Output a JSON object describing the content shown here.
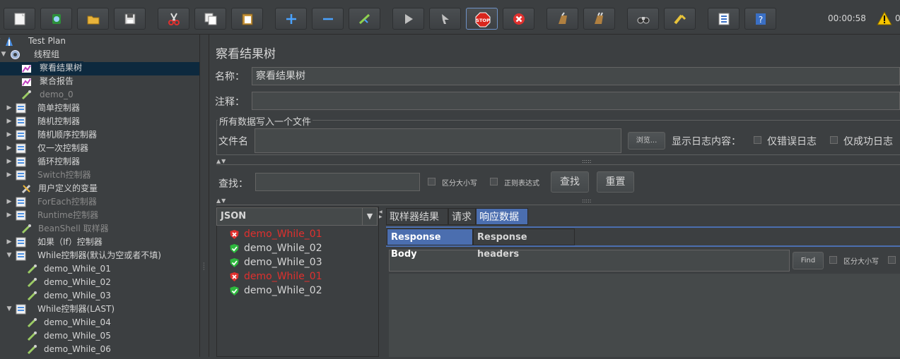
{
  "toolbar": {
    "buttons": [
      {
        "name": "new-icon"
      },
      {
        "name": "templates-icon"
      },
      {
        "name": "open-icon"
      },
      {
        "name": "save-icon"
      },
      {
        "name": "cut-icon"
      },
      {
        "name": "copy-icon"
      },
      {
        "name": "paste-icon"
      },
      {
        "name": "expand-icon"
      },
      {
        "name": "collapse-icon"
      },
      {
        "name": "toggle-icon"
      },
      {
        "name": "start-icon"
      },
      {
        "name": "start-no-pause-icon"
      },
      {
        "name": "stop-icon"
      },
      {
        "name": "shutdown-icon"
      },
      {
        "name": "clear-icon"
      },
      {
        "name": "clear-all-icon"
      },
      {
        "name": "search-icon"
      },
      {
        "name": "reset-search-icon"
      },
      {
        "name": "function-helper-icon"
      },
      {
        "name": "help-icon"
      }
    ],
    "stop_label": "STOP",
    "timer": "00:00:58",
    "warning_count": "0"
  },
  "tree": {
    "items": [
      {
        "label": "Test Plan",
        "icon": "test-plan-icon",
        "toggle": "▼",
        "disabled": false
      },
      {
        "label": "线程组",
        "icon": "gear-icon",
        "toggle": "▼",
        "disabled": false
      },
      {
        "label": "察看结果树",
        "icon": "listener-icon",
        "toggle": "",
        "disabled": false,
        "selected": true
      },
      {
        "label": "聚合报告",
        "icon": "listener-icon",
        "toggle": "",
        "disabled": false
      },
      {
        "label": "demo_0",
        "icon": "sampler-icon",
        "toggle": "",
        "disabled": true
      },
      {
        "label": "简单控制器",
        "icon": "controller-icon",
        "toggle": "▶",
        "disabled": false
      },
      {
        "label": "随机控制器",
        "icon": "controller-icon",
        "toggle": "▶",
        "disabled": false
      },
      {
        "label": "随机顺序控制器",
        "icon": "controller-icon",
        "toggle": "▶",
        "disabled": false
      },
      {
        "label": "仅一次控制器",
        "icon": "controller-icon",
        "toggle": "▶",
        "disabled": false
      },
      {
        "label": "循环控制器",
        "icon": "controller-icon",
        "toggle": "▶",
        "disabled": false
      },
      {
        "label": "Switch控制器",
        "icon": "controller-icon",
        "toggle": "▶",
        "disabled": true
      },
      {
        "label": "用户定义的变量",
        "icon": "wrench-icon",
        "toggle": "",
        "disabled": false
      },
      {
        "label": "ForEach控制器",
        "icon": "controller-icon",
        "toggle": "▶",
        "disabled": true
      },
      {
        "label": "Runtime控制器",
        "icon": "controller-icon",
        "toggle": "▶",
        "disabled": true
      },
      {
        "label": "BeanShell 取样器",
        "icon": "sampler-icon",
        "toggle": "",
        "disabled": true
      },
      {
        "label": "如果（If）控制器",
        "icon": "controller-icon",
        "toggle": "▶",
        "disabled": false
      },
      {
        "label": "While控制器(默认为空或者不填)",
        "icon": "controller-icon",
        "toggle": "▼",
        "disabled": false
      },
      {
        "label": "demo_While_01",
        "icon": "sampler-icon",
        "toggle": "",
        "disabled": false
      },
      {
        "label": "demo_While_02",
        "icon": "sampler-icon",
        "toggle": "",
        "disabled": false
      },
      {
        "label": "demo_While_03",
        "icon": "sampler-icon",
        "toggle": "",
        "disabled": false
      },
      {
        "label": "While控制器(LAST)",
        "icon": "controller-icon",
        "toggle": "▼",
        "disabled": false
      },
      {
        "label": "demo_While_04",
        "icon": "sampler-icon",
        "toggle": "",
        "disabled": false
      },
      {
        "label": "demo_While_05",
        "icon": "sampler-icon",
        "toggle": "",
        "disabled": false
      },
      {
        "label": "demo_While_06",
        "icon": "sampler-icon",
        "toggle": "",
        "disabled": false
      }
    ]
  },
  "panel": {
    "title": "察看结果树",
    "name_label": "名称：",
    "name_value": "察看结果树",
    "comment_label": "注释：",
    "comment_value": "",
    "file_group_title": "所有数据写入一个文件",
    "filename_label": "文件名",
    "filename_value": "",
    "browse_label": "浏览...",
    "log_label": "显示日志内容：",
    "errors_only_label": "仅错误日志",
    "success_only_label": "仅成功日志",
    "search_label": "查找：",
    "search_value": "",
    "case_sensitive_label": "区分大小写",
    "regex_label": "正则表达式",
    "find_button": "查找",
    "reset_button": "重置",
    "renderer_selected": "JSON",
    "results": [
      {
        "label": "demo_While_01",
        "status": "error"
      },
      {
        "label": "demo_While_02",
        "status": "ok"
      },
      {
        "label": "demo_While_03",
        "status": "ok"
      },
      {
        "label": "demo_While_01",
        "status": "error"
      },
      {
        "label": "demo_While_02",
        "status": "ok"
      }
    ],
    "tabs": [
      "取样器结果",
      "请求",
      "响应数据"
    ],
    "active_tab": "响应数据",
    "subtabs": [
      "Response Body",
      "Response headers"
    ],
    "active_subtab": "Response Body",
    "body_search_value": "",
    "body_find_label": "Find",
    "body_case_label": "区分大小写"
  },
  "colors": {
    "accent": "#4b6eaf",
    "error": "#e0302e",
    "ok": "#2db83d",
    "selection": "#0d293e"
  }
}
